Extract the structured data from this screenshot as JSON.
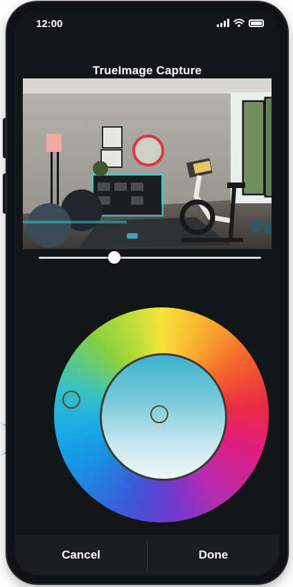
{
  "status_bar": {
    "time": "12:00"
  },
  "header": {
    "title": "TrueImage Capture"
  },
  "photo": {
    "description_icon": "room-photo"
  },
  "slider": {
    "value_fraction": 0.34
  },
  "color_wheel": {
    "accent_colors": [
      "#f9e23c",
      "#f4652c",
      "#e11d7d",
      "#6a3bd0",
      "#18a9e6",
      "#88d13e"
    ],
    "selected_color": "#2fb3d9"
  },
  "footer": {
    "cancel_label": "Cancel",
    "done_label": "Done"
  },
  "colors": {
    "background": "#141519",
    "accent_blue": "#1aa7e6"
  }
}
